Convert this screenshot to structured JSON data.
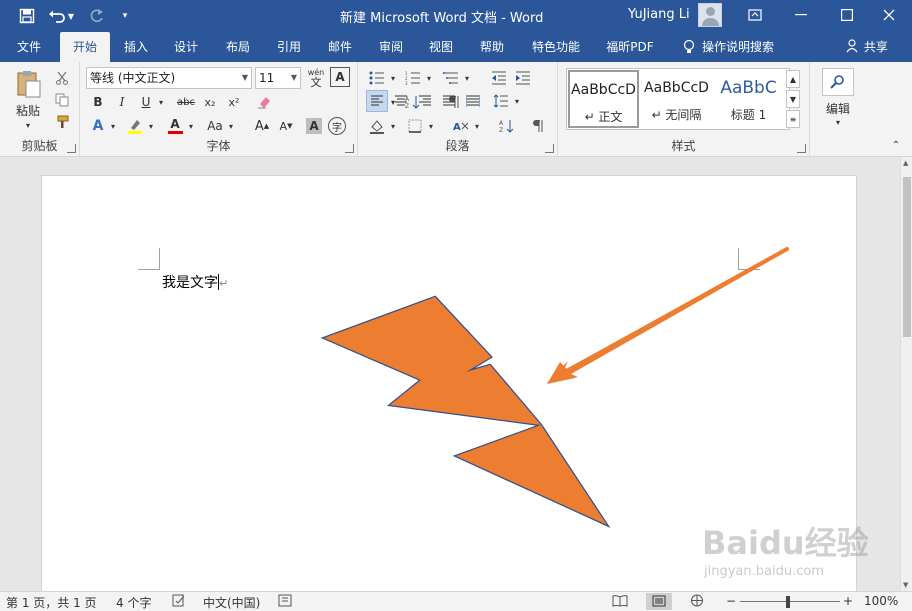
{
  "app": {
    "title": "新建 Microsoft Word 文档  -  Word",
    "user": "YuJiang Li",
    "accent": "#2b579a"
  },
  "quick_access": {
    "icons": [
      "save-icon",
      "undo-icon",
      "redo-icon",
      "customize-icon"
    ]
  },
  "tabs": [
    {
      "label": "文件"
    },
    {
      "label": "开始",
      "active": true
    },
    {
      "label": "插入"
    },
    {
      "label": "设计"
    },
    {
      "label": "布局"
    },
    {
      "label": "引用"
    },
    {
      "label": "邮件"
    },
    {
      "label": "审阅"
    },
    {
      "label": "视图"
    },
    {
      "label": "帮助"
    },
    {
      "label": "特色功能"
    },
    {
      "label": "福昕PDF"
    },
    {
      "label": "操作说明搜索"
    }
  ],
  "share_label": "共享",
  "ribbon": {
    "clipboard": {
      "label": "剪贴板",
      "paste": "粘贴"
    },
    "font": {
      "label": "字体",
      "font_name": "等线 (中文正文)",
      "font_size": "11",
      "bold": "B",
      "italic": "I",
      "underline": "U",
      "strike": "abc",
      "subscript": "x₂",
      "superscript": "x²",
      "wen": "wén",
      "change_case": "Aa",
      "grow": "A",
      "shrink": "A",
      "char_shade": "A",
      "encircle": "字"
    },
    "paragraph": {
      "label": "段落"
    },
    "styles": {
      "label": "样式",
      "items": [
        {
          "sample": "AaBbCcD",
          "name": "↵ 正文",
          "color": "#000000"
        },
        {
          "sample": "AaBbCcD",
          "name": "↵ 无间隔",
          "color": "#000000"
        },
        {
          "sample": "AaBbC",
          "name": "标题 1",
          "color": "#2e5c9e"
        }
      ]
    },
    "editing": {
      "label": "编辑"
    }
  },
  "document": {
    "text": "我是文字",
    "para_mark": "↵",
    "shape_fill": "#ed7d31",
    "shape_stroke": "#2f528f",
    "arrow_color": "#ed7d31"
  },
  "status": {
    "page": "第 1 页，共 1 页",
    "words": "4 个字",
    "language": "中文(中国)",
    "zoom": "100%"
  },
  "watermark": {
    "logo": "Baidu经验",
    "url": "jingyan.baidu.com"
  }
}
